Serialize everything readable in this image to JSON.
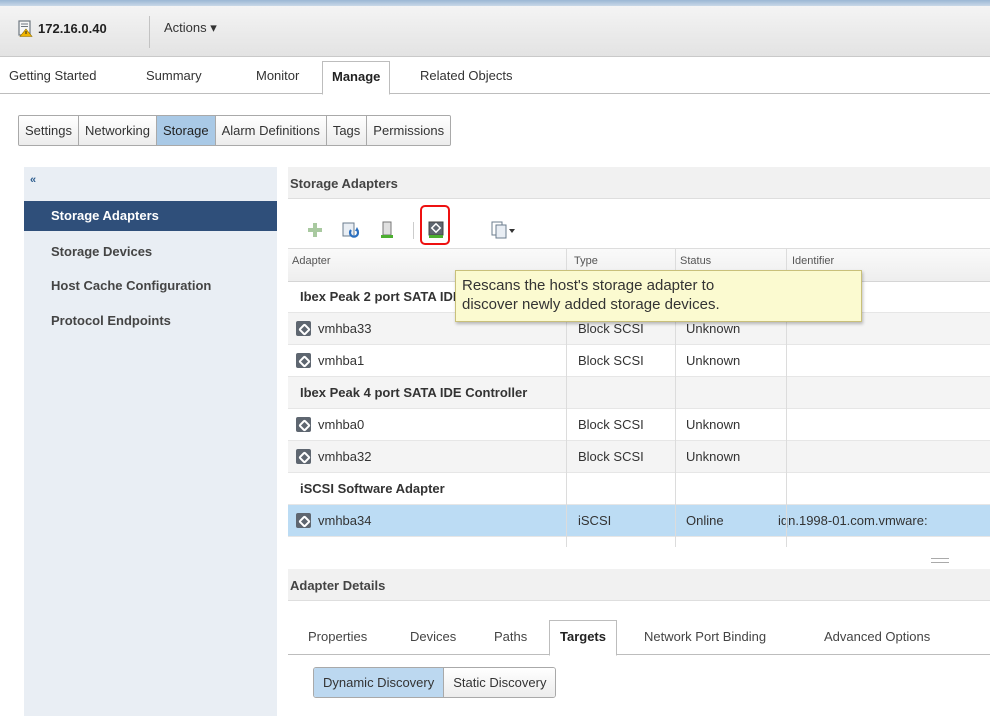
{
  "host": {
    "name": "172.16.0.40",
    "actions_label": "Actions ▾"
  },
  "nav_tabs": [
    "Getting Started",
    "Summary",
    "Monitor",
    "Manage",
    "Related Objects"
  ],
  "sub_tabs": [
    "Settings",
    "Networking",
    "Storage",
    "Alarm Definitions",
    "Tags",
    "Permissions"
  ],
  "sidebar": {
    "collapse": "«",
    "items": [
      "Storage Adapters",
      "Storage Devices",
      "Host Cache Configuration",
      "Protocol Endpoints"
    ]
  },
  "storage_adapters": {
    "title": "Storage Adapters",
    "columns": [
      "Adapter",
      "Type",
      "Status",
      "Identifier"
    ],
    "groups": [
      "Ibex Peak 2 port SATA IDE Controller",
      "Ibex Peak 4 port SATA IDE Controller",
      "iSCSI Software Adapter"
    ],
    "rows": [
      {
        "adapter": "vmhba33",
        "type": "Block SCSI",
        "status": "Unknown",
        "identifier": ""
      },
      {
        "adapter": "vmhba1",
        "type": "Block SCSI",
        "status": "Unknown",
        "identifier": ""
      },
      {
        "adapter": "vmhba0",
        "type": "Block SCSI",
        "status": "Unknown",
        "identifier": ""
      },
      {
        "adapter": "vmhba32",
        "type": "Block SCSI",
        "status": "Unknown",
        "identifier": ""
      },
      {
        "adapter": "vmhba34",
        "type": "iSCSI",
        "status": "Online",
        "identifier": "iqn.1998-01.com.vmware:"
      }
    ]
  },
  "tooltip": {
    "line1": "Rescans the host's storage adapter to",
    "line2": "discover newly added storage devices."
  },
  "adapter_details": {
    "title": "Adapter Details",
    "tabs": [
      "Properties",
      "Devices",
      "Paths",
      "Targets",
      "Network Port Binding",
      "Advanced Options"
    ],
    "discovery": [
      "Dynamic Discovery",
      "Static Discovery"
    ]
  }
}
